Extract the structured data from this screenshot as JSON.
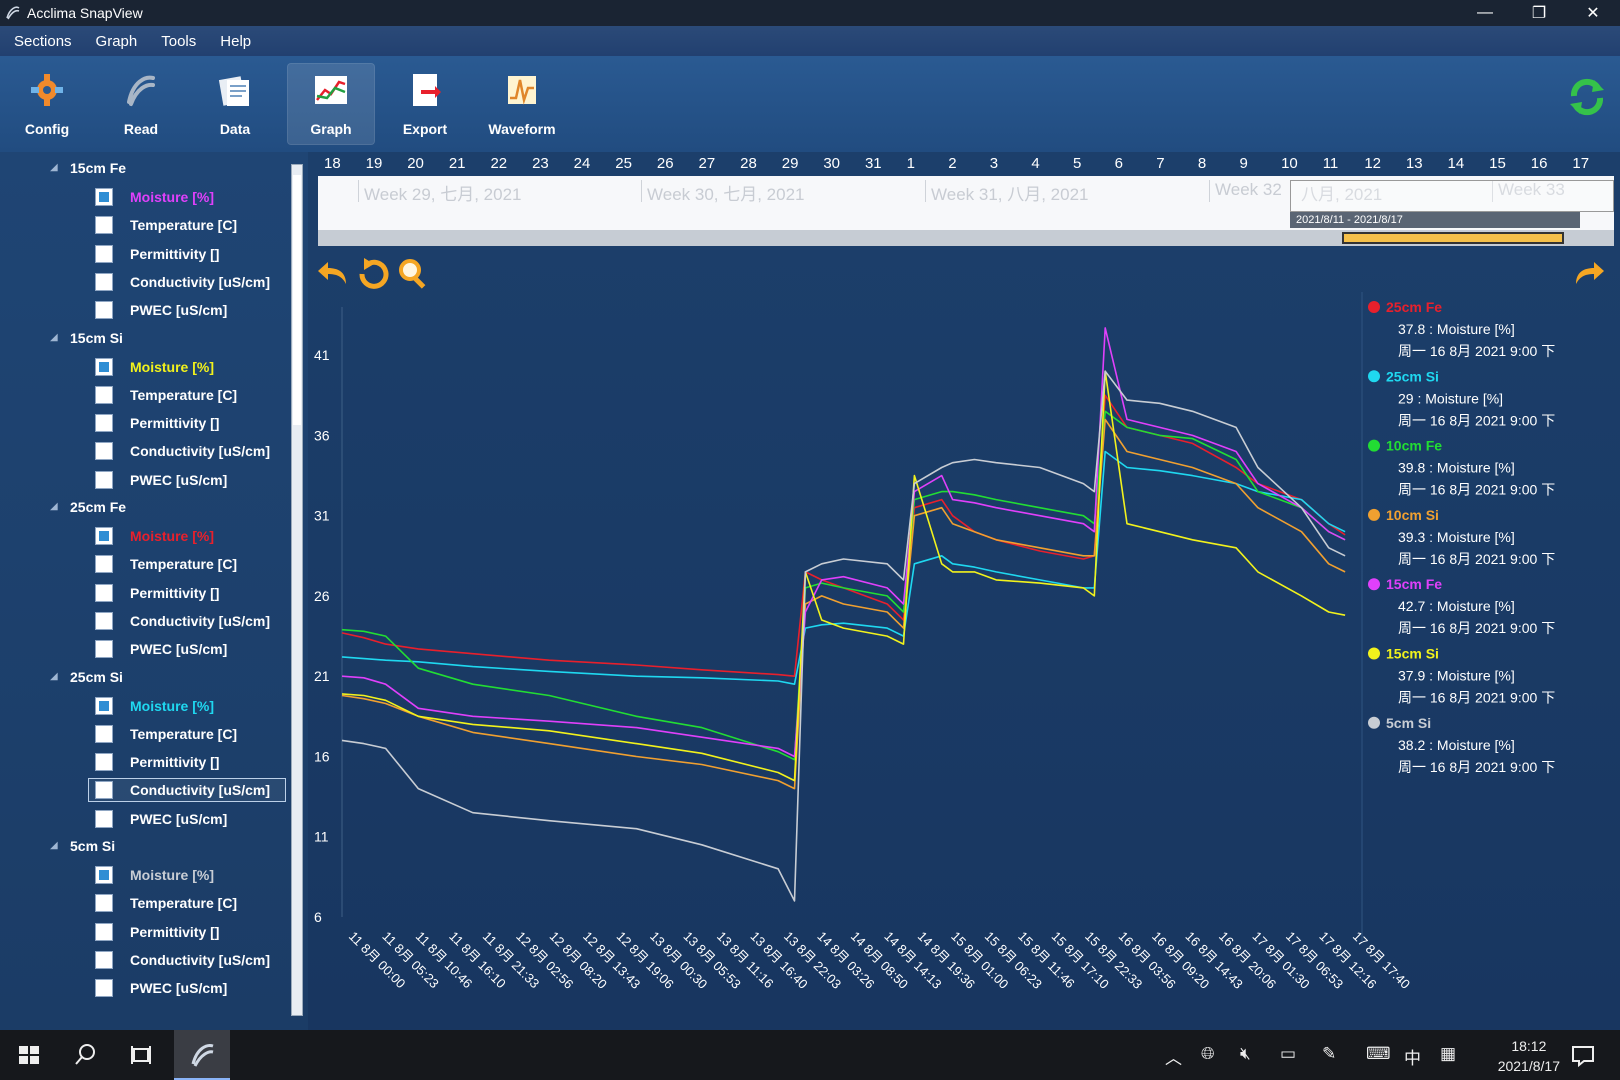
{
  "window": {
    "title": "Acclima SnapView"
  },
  "menu": [
    "Sections",
    "Graph",
    "Tools",
    "Help"
  ],
  "toolbar": [
    {
      "label": "Config",
      "icon": "config-icon"
    },
    {
      "label": "Read",
      "icon": "read-icon"
    },
    {
      "label": "Data",
      "icon": "data-icon"
    },
    {
      "label": "Graph",
      "icon": "graph-icon",
      "active": true
    },
    {
      "label": "Export",
      "icon": "export-icon"
    },
    {
      "label": "Waveform",
      "icon": "waveform-icon"
    }
  ],
  "sidebar": {
    "groups": [
      {
        "title": "15cm Fe",
        "items": [
          {
            "label": "Moisture [%]",
            "checked": true,
            "color": "#e040fb"
          },
          {
            "label": "Temperature [C]"
          },
          {
            "label": "Permittivity []"
          },
          {
            "label": "Conductivity [uS/cm]"
          },
          {
            "label": "PWEC [uS/cm]"
          }
        ]
      },
      {
        "title": "15cm Si",
        "items": [
          {
            "label": "Moisture [%]",
            "checked": true,
            "color": "#f2f21c"
          },
          {
            "label": "Temperature [C]"
          },
          {
            "label": "Permittivity []"
          },
          {
            "label": "Conductivity [uS/cm]"
          },
          {
            "label": "PWEC [uS/cm]"
          }
        ]
      },
      {
        "title": "25cm Fe",
        "items": [
          {
            "label": "Moisture [%]",
            "checked": true,
            "color": "#e8202c"
          },
          {
            "label": "Temperature [C]"
          },
          {
            "label": "Permittivity []"
          },
          {
            "label": "Conductivity [uS/cm]"
          },
          {
            "label": "PWEC [uS/cm]"
          }
        ]
      },
      {
        "title": "25cm Si",
        "items": [
          {
            "label": "Moisture [%]",
            "checked": true,
            "color": "#1fd8f0"
          },
          {
            "label": "Temperature [C]"
          },
          {
            "label": "Permittivity []"
          },
          {
            "label": "Conductivity [uS/cm]",
            "selected": true
          },
          {
            "label": "PWEC [uS/cm]"
          }
        ]
      },
      {
        "title": "5cm Si",
        "items": [
          {
            "label": "Moisture [%]",
            "checked": true,
            "color": "#c8cdd4"
          },
          {
            "label": "Temperature [C]"
          },
          {
            "label": "Permittivity []"
          },
          {
            "label": "Conductivity [uS/cm]"
          },
          {
            "label": "PWEC [uS/cm]"
          }
        ]
      }
    ]
  },
  "timeline": {
    "days": [
      "18",
      "19",
      "20",
      "21",
      "22",
      "23",
      "24",
      "25",
      "26",
      "27",
      "28",
      "29",
      "30",
      "31",
      "1",
      "2",
      "3",
      "4",
      "5",
      "6",
      "7",
      "8",
      "9",
      "10",
      "11",
      "12",
      "13",
      "14",
      "15",
      "16",
      "17"
    ],
    "weeks": [
      "Week 29, 七月, 2021",
      "Week 30, 七月, 2021",
      "Week 31, 八月, 2021",
      "Week 32",
      "八月, 2021",
      "Week 33"
    ],
    "range_label": "2021/8/11 - 2021/8/17"
  },
  "chart_data": {
    "type": "line",
    "ylim": [
      6,
      44
    ],
    "yticks": [
      41,
      36,
      31,
      26,
      21,
      16,
      11,
      6
    ],
    "xticks": [
      "11 8月 00:00",
      "11 8月 05:23",
      "11 8月 10:46",
      "11 8月 16:10",
      "11 8月 21:33",
      "12 8月 02:56",
      "12 8月 08:20",
      "12 8月 13:43",
      "12 8月 19:06",
      "13 8月 00:30",
      "13 8月 05:53",
      "13 8月 11:16",
      "13 8月 16:40",
      "13 8月 22:03",
      "14 8月 03:26",
      "14 8月 08:50",
      "14 8月 14:13",
      "14 8月 19:36",
      "15 8月 01:00",
      "15 8月 06:23",
      "15 8月 11:46",
      "15 8月 17:10",
      "15 8月 22:33",
      "16 8月 03:56",
      "16 8月 09:20",
      "16 8月 14:43",
      "16 8月 20:06",
      "17 8月 01:30",
      "17 8月 06:53",
      "17 8月 12:16",
      "17 8月 17:40"
    ],
    "x_hours": [
      0,
      4,
      8,
      14,
      24,
      38,
      54,
      66,
      80,
      83,
      85,
      88,
      92,
      100,
      103,
      105,
      110,
      112,
      116,
      120,
      128,
      136,
      138,
      140,
      144,
      150,
      156,
      164,
      168,
      176,
      181,
      184
    ],
    "series": [
      {
        "name": "25cm Fe",
        "color": "#e8202c",
        "values": [
          23.7,
          23.4,
          23.0,
          22.7,
          22.4,
          22.0,
          21.7,
          21.4,
          21.1,
          21.0,
          27.5,
          27.0,
          26.5,
          25.5,
          24.5,
          31.5,
          32.0,
          31.0,
          30.0,
          29.5,
          28.8,
          28.3,
          28.5,
          38.5,
          36.5,
          36.0,
          35.5,
          34.0,
          33.0,
          32.0,
          30.5,
          29.8
        ]
      },
      {
        "name": "25cm Si",
        "color": "#1fd8f0",
        "values": [
          22.2,
          22.1,
          22.0,
          21.9,
          21.6,
          21.3,
          21.0,
          20.9,
          20.7,
          20.5,
          24.0,
          24.2,
          24.3,
          24.0,
          23.5,
          28.0,
          28.5,
          28.0,
          27.8,
          27.5,
          27.0,
          26.5,
          26.5,
          35.0,
          34.0,
          33.8,
          33.5,
          33.0,
          32.5,
          32.0,
          30.5,
          30.0
        ]
      },
      {
        "name": "10cm Fe",
        "color": "#22dd33",
        "values": [
          23.9,
          23.8,
          23.5,
          21.5,
          20.5,
          19.8,
          18.5,
          17.8,
          16.3,
          15.8,
          26.5,
          26.8,
          26.5,
          26.0,
          25.0,
          32.0,
          32.5,
          32.5,
          32.3,
          32.0,
          31.5,
          31.0,
          30.5,
          37.5,
          36.5,
          36.0,
          35.8,
          34.5,
          32.5,
          31.5,
          30.0,
          29.5
        ]
      },
      {
        "name": "10cm Si",
        "color": "#f0a030",
        "values": [
          19.8,
          19.6,
          19.3,
          18.5,
          17.5,
          16.8,
          16.0,
          15.5,
          14.5,
          14.0,
          25.5,
          26.0,
          25.5,
          25.0,
          24.0,
          31.0,
          31.5,
          30.5,
          30.0,
          29.5,
          29.0,
          28.5,
          28.5,
          37.0,
          35.0,
          34.5,
          34.0,
          33.0,
          31.5,
          30.0,
          28.0,
          27.5
        ]
      },
      {
        "name": "15cm Fe",
        "color": "#e040fb",
        "values": [
          21.0,
          20.9,
          20.5,
          19.0,
          18.5,
          18.2,
          17.8,
          17.2,
          16.5,
          16.0,
          25.0,
          27.0,
          27.2,
          26.5,
          25.5,
          32.5,
          33.5,
          32.0,
          31.8,
          31.5,
          31.0,
          30.5,
          30.0,
          42.7,
          37.0,
          36.5,
          36.0,
          35.0,
          33.0,
          31.5,
          30.0,
          29.5
        ]
      },
      {
        "name": "15cm Si",
        "color": "#f2f21c",
        "values": [
          19.9,
          19.8,
          19.5,
          18.5,
          18.0,
          17.6,
          16.8,
          16.2,
          15.0,
          14.5,
          27.5,
          24.5,
          24.0,
          23.5,
          23.0,
          33.5,
          28.0,
          27.5,
          27.5,
          27.0,
          26.8,
          26.5,
          26.0,
          40.0,
          30.5,
          30.0,
          29.5,
          29.0,
          27.5,
          26.0,
          25.0,
          24.8
        ]
      },
      {
        "name": "5cm Si",
        "color": "#c8cdd4",
        "values": [
          17.0,
          16.8,
          16.5,
          14.0,
          12.5,
          12.0,
          11.5,
          10.5,
          9.0,
          7.0,
          27.5,
          28.0,
          28.3,
          28.0,
          27.0,
          33.0,
          34.0,
          34.3,
          34.5,
          34.3,
          34.0,
          33.0,
          32.5,
          40.0,
          38.2,
          38.0,
          37.5,
          36.5,
          34.0,
          31.5,
          29.0,
          28.5
        ]
      }
    ]
  },
  "legend": [
    {
      "name": "25cm Fe",
      "color": "#e8202c",
      "value": "37.8 : Moisture [%]",
      "time": "周一 16 8月 2021 9:00 下"
    },
    {
      "name": "25cm Si",
      "color": "#1fd8f0",
      "value": "29 : Moisture [%]",
      "time": "周一 16 8月 2021 9:00 下"
    },
    {
      "name": "10cm Fe",
      "color": "#22dd33",
      "value": "39.8 : Moisture [%]",
      "time": "周一 16 8月 2021 9:00 下"
    },
    {
      "name": "10cm Si",
      "color": "#f0a030",
      "value": "39.3 : Moisture [%]",
      "time": "周一 16 8月 2021 9:00 下"
    },
    {
      "name": "15cm Fe",
      "color": "#e040fb",
      "value": "42.7 : Moisture [%]",
      "time": "周一 16 8月 2021 9:00 下"
    },
    {
      "name": "15cm Si",
      "color": "#f2f21c",
      "value": "37.9 : Moisture [%]",
      "time": "周一 16 8月 2021 9:00 下"
    },
    {
      "name": "5cm Si",
      "color": "#c8cdd4",
      "value": "38.2 : Moisture [%]",
      "time": "周一 16 8月 2021 9:00 下"
    }
  ],
  "taskbar": {
    "time": "18:12",
    "date": "2021/8/17",
    "ime": "中"
  }
}
